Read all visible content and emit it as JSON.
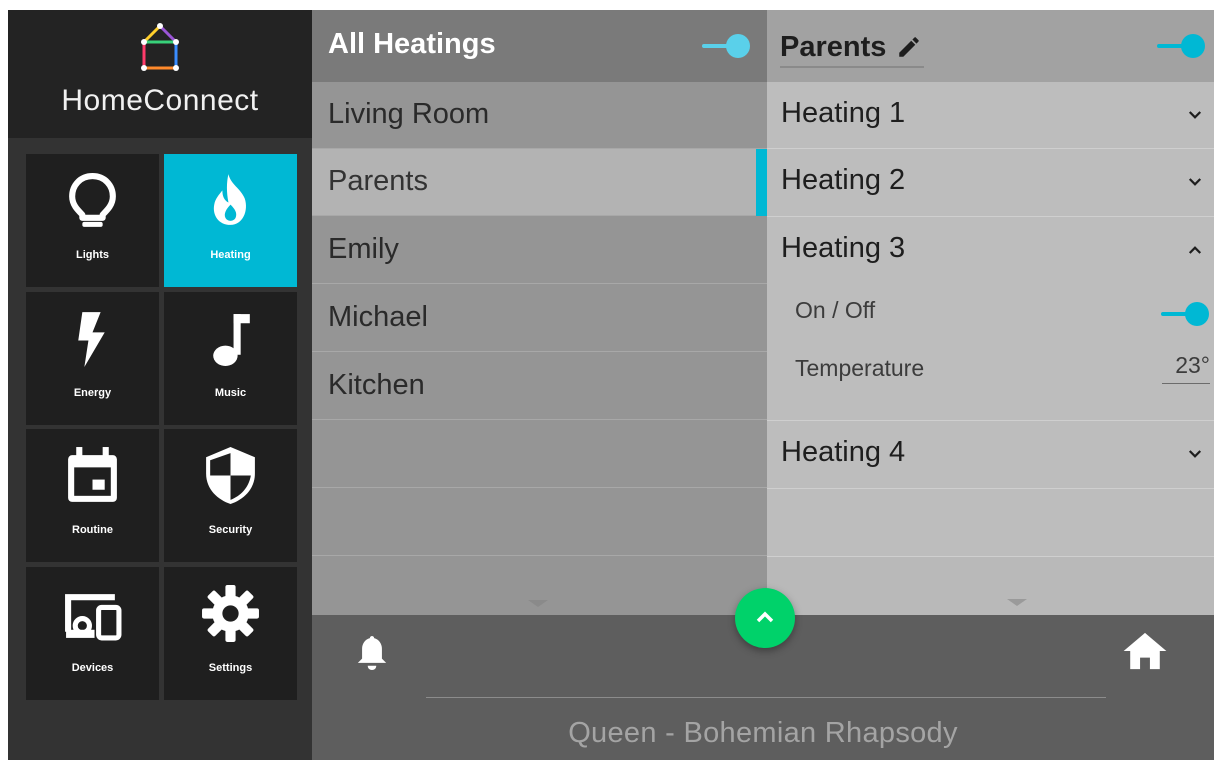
{
  "brand": {
    "name": "HomeConnect"
  },
  "sidebar": {
    "items": [
      {
        "label": "Lights",
        "icon": "lightbulb-icon"
      },
      {
        "label": "Heating",
        "icon": "flame-icon",
        "active": true
      },
      {
        "label": "Energy",
        "icon": "lightning-icon"
      },
      {
        "label": "Music",
        "icon": "music-note-icon"
      },
      {
        "label": "Routine",
        "icon": "calendar-icon"
      },
      {
        "label": "Security",
        "icon": "shield-icon"
      },
      {
        "label": "Devices",
        "icon": "devices-icon"
      },
      {
        "label": "Settings",
        "icon": "gear-icon"
      }
    ]
  },
  "rooms": {
    "title": "All Heatings",
    "toggle_on": true,
    "items": [
      "Living Room",
      "Parents",
      "Emily",
      "Michael",
      "Kitchen"
    ],
    "selected": "Parents"
  },
  "detail": {
    "title": "Parents",
    "toggle_on": true,
    "heatings": [
      {
        "label": "Heating 1",
        "expanded": false
      },
      {
        "label": "Heating 2",
        "expanded": false
      },
      {
        "label": "Heating 3",
        "expanded": true,
        "onoff_label": "On / Off",
        "on": true,
        "temperature_label": "Temperature",
        "temperature_value": "23°"
      },
      {
        "label": "Heating 4",
        "expanded": false
      }
    ]
  },
  "now_playing": "Queen - Bohemian Rhapsody",
  "colors": {
    "accent": "#00b8d4",
    "fab": "#00d26a",
    "toggle_light": "#5ad0ea"
  }
}
